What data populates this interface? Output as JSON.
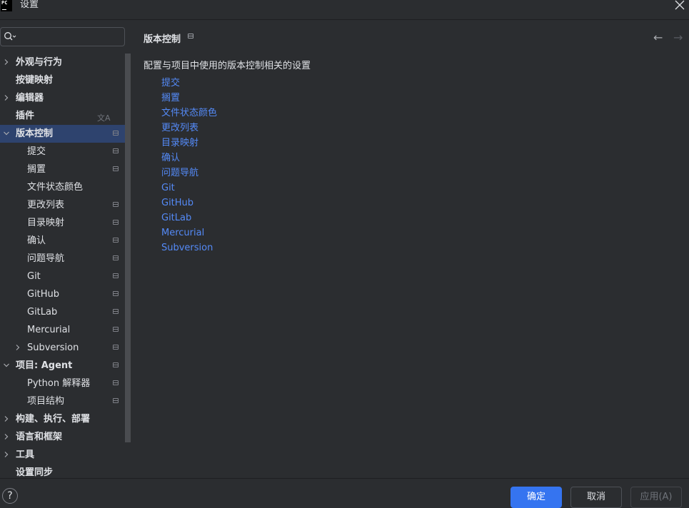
{
  "window": {
    "title": "设置",
    "logo_text": "PC"
  },
  "search": {
    "value": "",
    "placeholder": ""
  },
  "tree": [
    {
      "label": "外观与行为",
      "depth": 0,
      "bold": true,
      "expandable": true,
      "expanded": false,
      "pinned": false
    },
    {
      "label": "按键映射",
      "depth": 0,
      "bold": true,
      "expandable": false,
      "pinned": false
    },
    {
      "label": "编辑器",
      "depth": 0,
      "bold": true,
      "expandable": true,
      "expanded": false,
      "pinned": false
    },
    {
      "label": "插件",
      "depth": 0,
      "bold": true,
      "expandable": false,
      "pinned": false,
      "translate": true
    },
    {
      "label": "版本控制",
      "depth": 0,
      "bold": true,
      "expandable": true,
      "expanded": true,
      "pinned": true,
      "selected": true
    },
    {
      "label": "提交",
      "depth": 1,
      "expandable": false,
      "pinned": true
    },
    {
      "label": "搁置",
      "depth": 1,
      "expandable": false,
      "pinned": true
    },
    {
      "label": "文件状态颜色",
      "depth": 1,
      "expandable": false,
      "pinned": false
    },
    {
      "label": "更改列表",
      "depth": 1,
      "expandable": false,
      "pinned": true
    },
    {
      "label": "目录映射",
      "depth": 1,
      "expandable": false,
      "pinned": true
    },
    {
      "label": "确认",
      "depth": 1,
      "expandable": false,
      "pinned": true
    },
    {
      "label": "问题导航",
      "depth": 1,
      "expandable": false,
      "pinned": true
    },
    {
      "label": "Git",
      "depth": 1,
      "expandable": false,
      "pinned": true
    },
    {
      "label": "GitHub",
      "depth": 1,
      "expandable": false,
      "pinned": true
    },
    {
      "label": "GitLab",
      "depth": 1,
      "expandable": false,
      "pinned": true
    },
    {
      "label": "Mercurial",
      "depth": 1,
      "expandable": false,
      "pinned": true
    },
    {
      "label": "Subversion",
      "depth": 1,
      "expandable": true,
      "expanded": false,
      "pinned": true
    },
    {
      "label": "项目: Agent",
      "depth": 0,
      "bold": true,
      "expandable": true,
      "expanded": true,
      "pinned": true
    },
    {
      "label": "Python 解释器",
      "depth": 1,
      "expandable": false,
      "pinned": true
    },
    {
      "label": "项目结构",
      "depth": 1,
      "expandable": false,
      "pinned": true
    },
    {
      "label": "构建、执行、部署",
      "depth": 0,
      "bold": true,
      "expandable": true,
      "expanded": false,
      "pinned": false
    },
    {
      "label": "语言和框架",
      "depth": 0,
      "bold": true,
      "expandable": true,
      "expanded": false,
      "pinned": false
    },
    {
      "label": "工具",
      "depth": 0,
      "bold": true,
      "expandable": true,
      "expanded": false,
      "pinned": false
    },
    {
      "label": "设置同步",
      "depth": 0,
      "bold": true,
      "expandable": false,
      "pinned": false
    }
  ],
  "content": {
    "breadcrumb": "版本控制",
    "description": "配置与项目中使用的版本控制相关的设置",
    "links": [
      "提交",
      "搁置",
      "文件状态颜色",
      "更改列表",
      "目录映射",
      "确认",
      "问题导航",
      "Git",
      "GitHub",
      "GitLab",
      "Mercurial",
      "Subversion"
    ]
  },
  "footer": {
    "help": "?",
    "ok": "确定",
    "cancel": "取消",
    "apply": "应用(A)"
  },
  "colors": {
    "accent": "#3574f0",
    "link": "#548af7",
    "selection": "#2e436e",
    "background": "#2b2d30"
  }
}
